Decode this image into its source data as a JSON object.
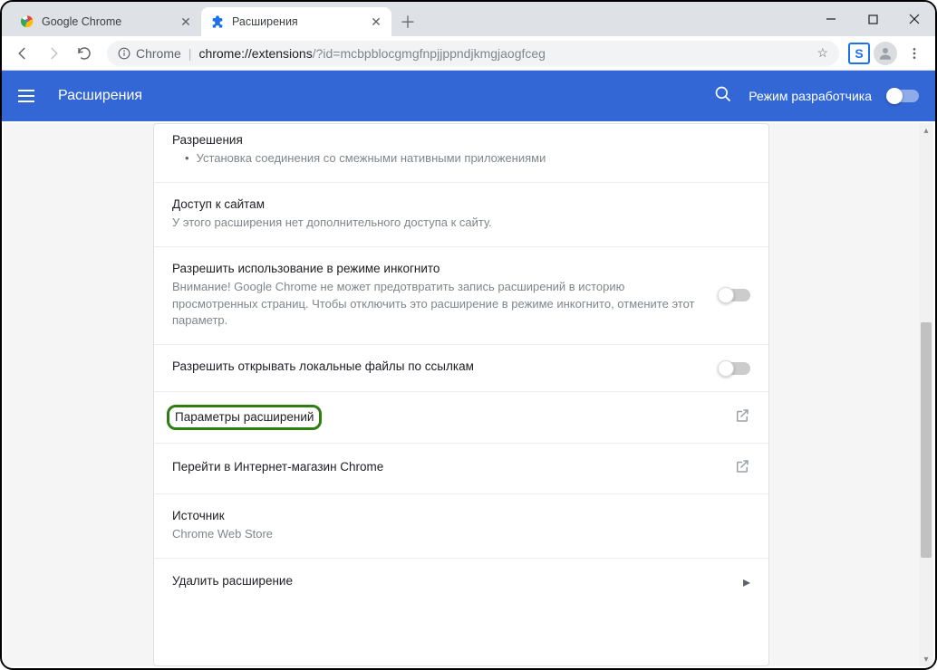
{
  "tabs": [
    {
      "title": "Google Chrome",
      "active": false
    },
    {
      "title": "Расширения",
      "active": true
    }
  ],
  "omnibox": {
    "scheme_label": "Chrome",
    "host": "chrome://extensions",
    "path": "/?id=mcbpblocgmgfnpjjppndjkmgjaogfceg"
  },
  "app_bar": {
    "title": "Расширения",
    "dev_mode_label": "Режим разработчика"
  },
  "sections": {
    "permissions": {
      "title": "Разрешения",
      "item": "Установка соединения со смежными нативными приложениями"
    },
    "site_access": {
      "title": "Доступ к сайтам",
      "desc": "У этого расширения нет дополнительного доступа к сайту."
    },
    "incognito": {
      "title": "Разрешить использование в режиме инкогнито",
      "desc": "Внимание! Google Chrome не может предотвратить запись расширений в историю просмотренных страниц. Чтобы отключить это расширение в режиме инкогнито, отмените этот параметр."
    },
    "file_urls": {
      "title": "Разрешить открывать локальные файлы по ссылкам"
    },
    "ext_options": {
      "title": "Параметры расширений"
    },
    "webstore": {
      "title": "Перейти в Интернет-магазин Chrome"
    },
    "source": {
      "title": "Источник",
      "value": "Chrome Web Store"
    },
    "remove": {
      "title": "Удалить расширение"
    }
  }
}
